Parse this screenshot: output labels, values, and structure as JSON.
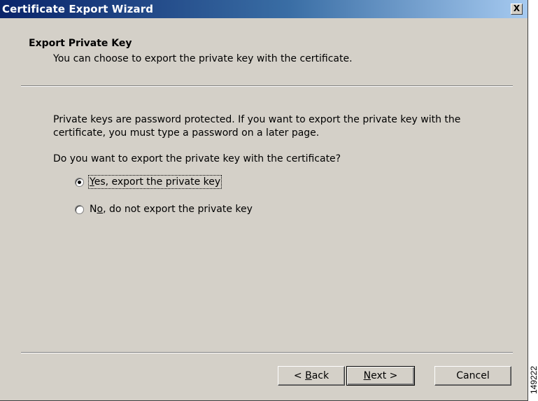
{
  "window": {
    "title": "Certificate Export Wizard",
    "close_label": "X"
  },
  "header": {
    "title": "Export Private Key",
    "subtitle": "You can choose to export the private key with the certificate."
  },
  "body": {
    "paragraph_line1": "Private keys are password protected. If you want to export the private key with the",
    "paragraph_line2": "certificate, you must type a password on a later page.",
    "question": "Do you want to export the private key with the certificate?"
  },
  "options": [
    {
      "prefix": "",
      "accel": "Y",
      "rest": "es, export the private key",
      "selected": true
    },
    {
      "prefix": "N",
      "accel": "o",
      "rest": ", do not export the private key",
      "selected": false
    }
  ],
  "buttons": {
    "back": {
      "prefix": "< ",
      "accel": "B",
      "rest": "ack"
    },
    "next": {
      "prefix": "",
      "accel": "N",
      "rest": "ext >"
    },
    "cancel": "Cancel"
  },
  "figure_number": "149222",
  "colors": {
    "title_bar_start": "#0a246a",
    "title_bar_end": "#a6caf0",
    "dialog_face": "#d4d0c8"
  }
}
